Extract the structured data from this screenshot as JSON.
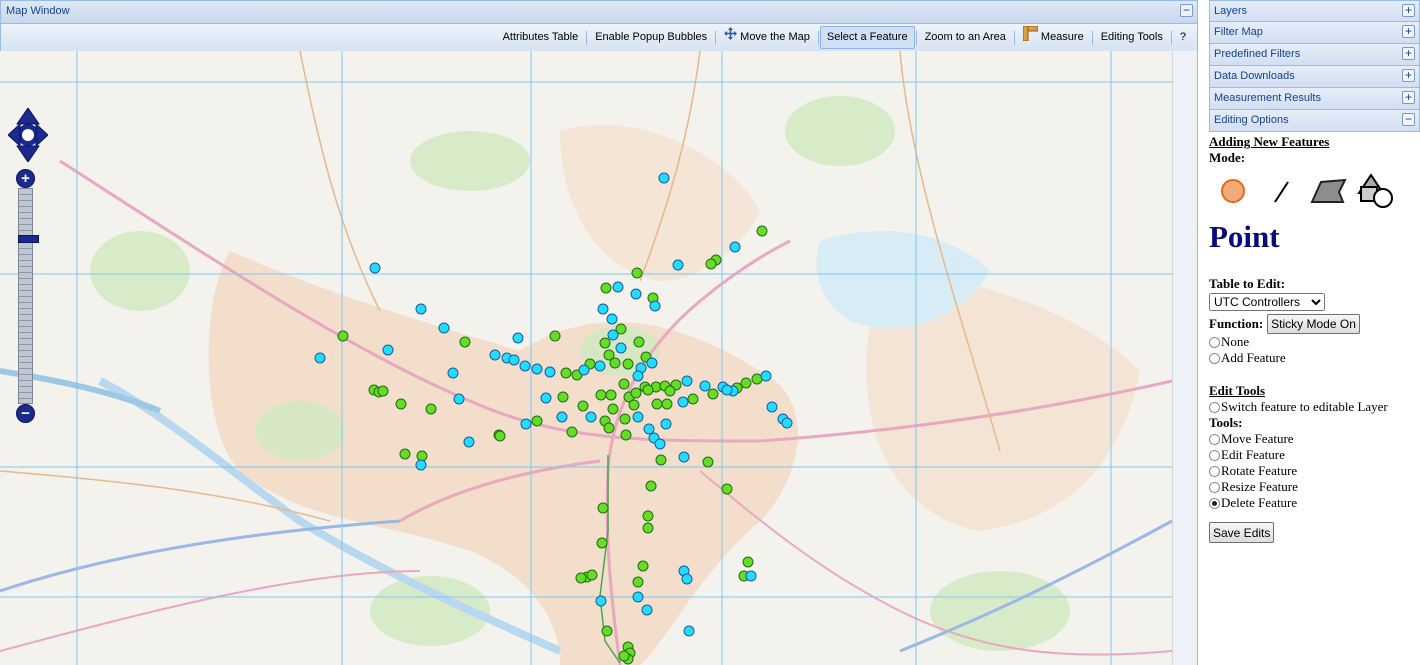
{
  "map_window": {
    "title": "Map Window",
    "collapse_icon": "minus-icon",
    "toolbar": [
      {
        "id": "attributes",
        "label": "Attributes Table",
        "icon": null,
        "active": false
      },
      {
        "id": "popup",
        "label": "Enable Popup Bubbles",
        "icon": null,
        "active": false
      },
      {
        "id": "move",
        "label": "Move the Map",
        "icon": "move-arrows-icon",
        "active": false
      },
      {
        "id": "select",
        "label": "Select a Feature",
        "icon": null,
        "active": true
      },
      {
        "id": "zoom",
        "label": "Zoom to an Area",
        "icon": null,
        "active": false
      },
      {
        "id": "measure",
        "label": "Measure",
        "icon": "ruler-icon",
        "active": false
      },
      {
        "id": "editing",
        "label": "Editing Tools",
        "icon": null,
        "active": false
      },
      {
        "id": "help",
        "label": "?",
        "icon": null,
        "active": false
      }
    ],
    "zoom_in_label": "+",
    "zoom_out_label": "−",
    "zoom_level_fraction": 0.78
  },
  "map": {
    "green_color": "#66dd22",
    "blue_color": "#22ddff",
    "marker_stroke": "#1d6b1d",
    "blue_stroke": "#1a5aa0"
  },
  "side_panel": {
    "accordion": [
      {
        "id": "layers",
        "label": "Layers",
        "expanded": false
      },
      {
        "id": "filter",
        "label": "Filter Map",
        "expanded": false
      },
      {
        "id": "predef",
        "label": "Predefined Filters",
        "expanded": false
      },
      {
        "id": "downloads",
        "label": "Data Downloads",
        "expanded": false
      },
      {
        "id": "measure",
        "label": "Measurement Results",
        "expanded": false
      },
      {
        "id": "editing",
        "label": "Editing Options",
        "expanded": true
      }
    ],
    "toggle_plus": "+",
    "toggle_minus": "−",
    "editing": {
      "adding_heading": "Adding New Features",
      "mode_label": "Mode:",
      "mode_icons": [
        "point-icon",
        "line-icon",
        "polygon-icon",
        "shapes-icon"
      ],
      "mode_name": "Point",
      "table_label": "Table to Edit:",
      "table_value": "UTC Controllers",
      "function_label": "Function:",
      "sticky_button": "Sticky Mode On",
      "function_options": [
        {
          "label": "None",
          "checked": false
        },
        {
          "label": "Add Feature",
          "checked": false
        }
      ],
      "edit_tools_heading": "Edit Tools",
      "switch_option": {
        "label": "Switch feature to editable Layer",
        "checked": false
      },
      "tools_label": "Tools:",
      "tool_options": [
        {
          "label": "Move Feature",
          "checked": false
        },
        {
          "label": "Edit Feature",
          "checked": false
        },
        {
          "label": "Rotate Feature",
          "checked": false
        },
        {
          "label": "Resize Feature",
          "checked": false
        },
        {
          "label": "Delete Feature",
          "checked": true
        }
      ],
      "save_button": "Save Edits"
    }
  }
}
